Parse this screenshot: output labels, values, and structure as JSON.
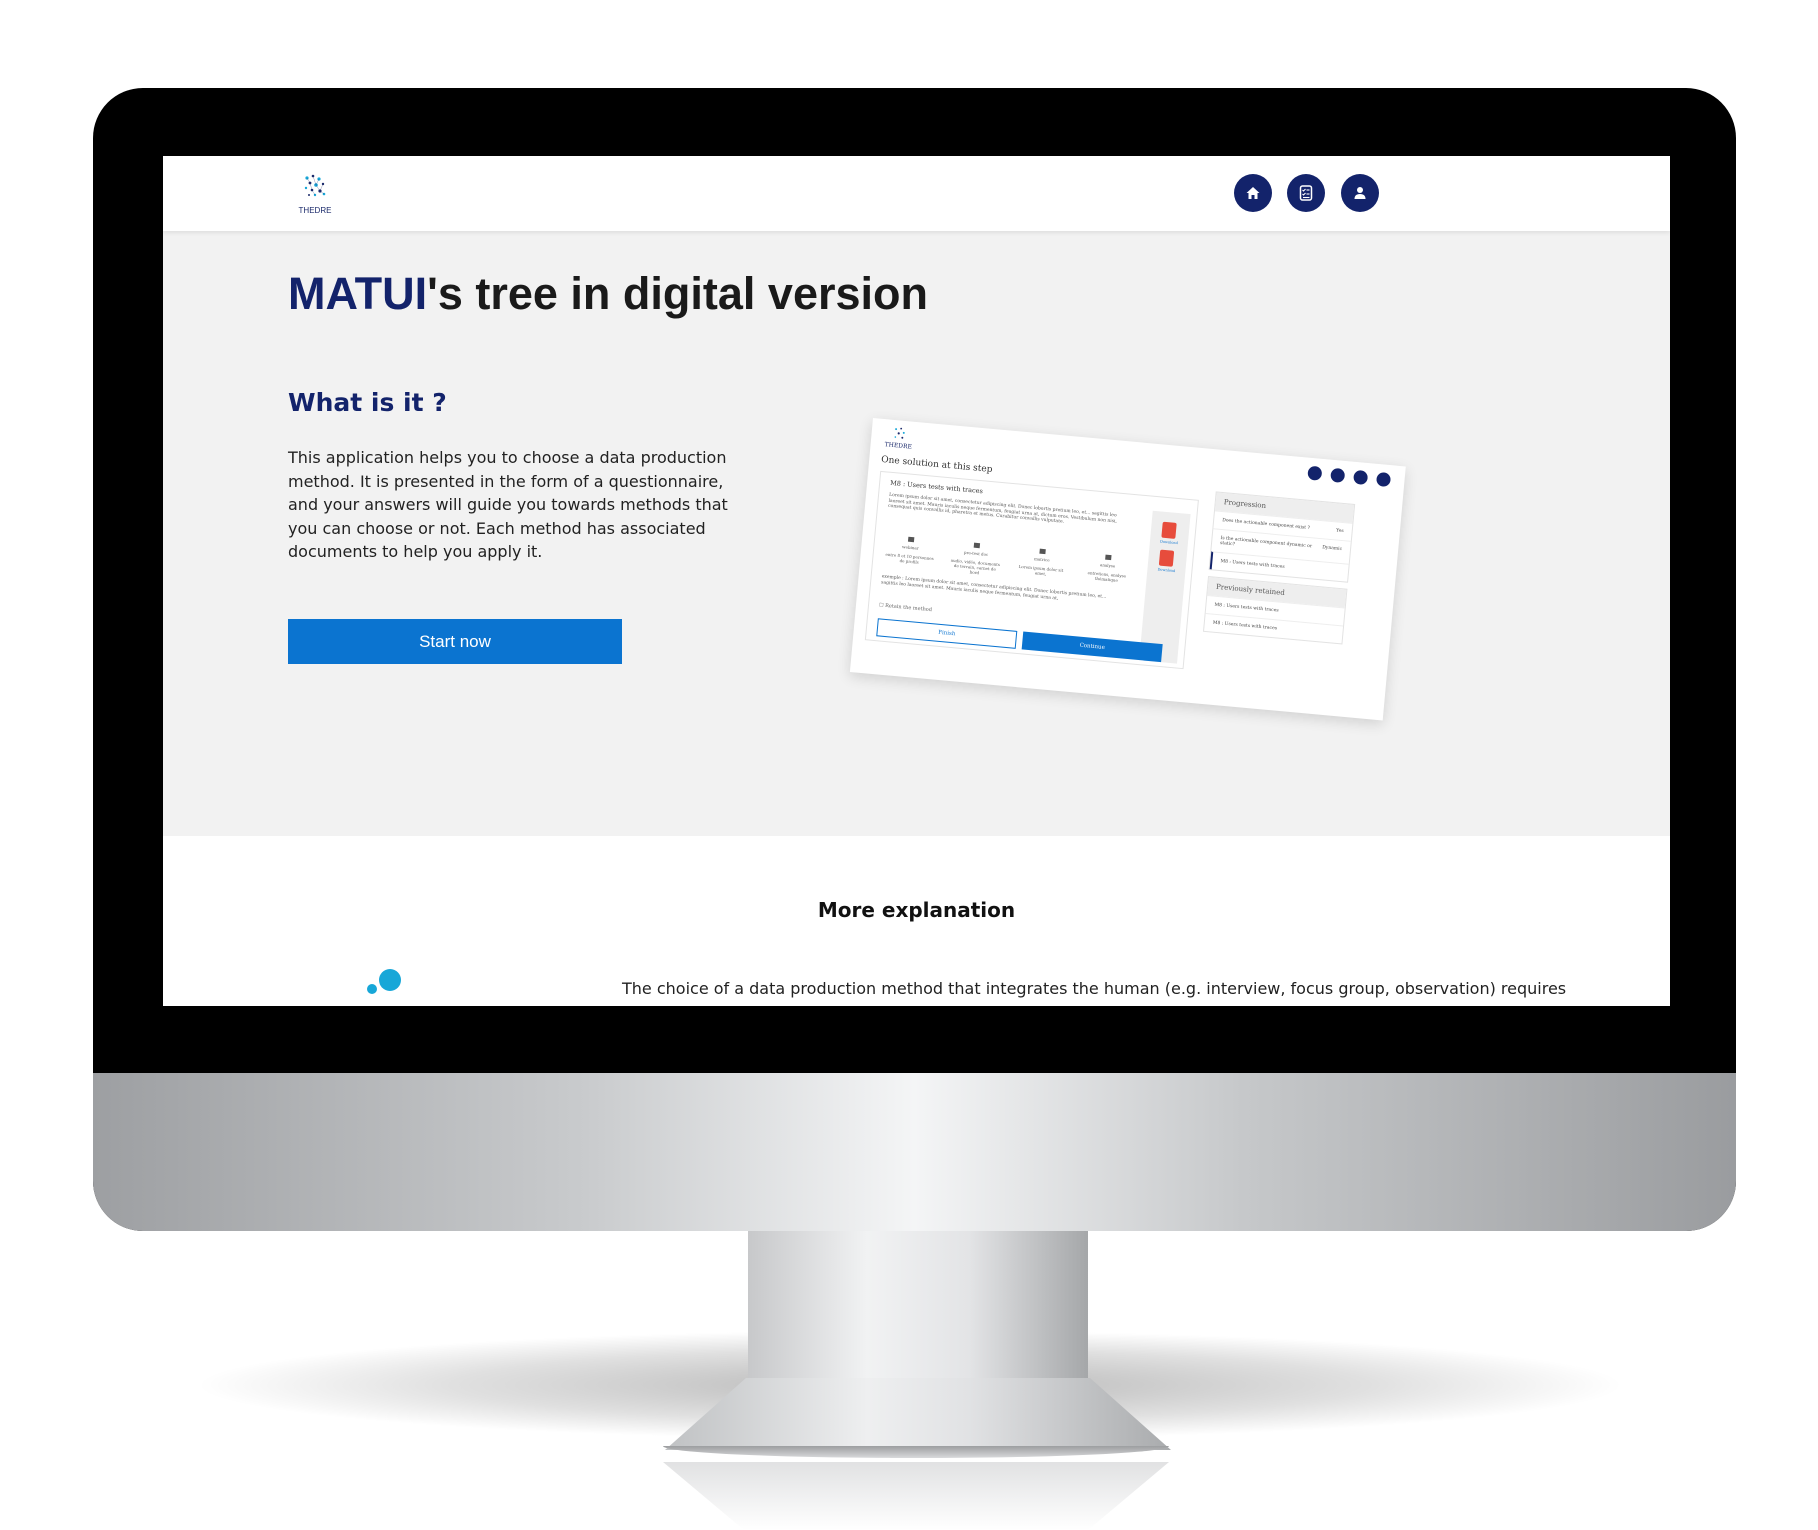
{
  "header": {
    "logo_text": "THEDRE",
    "nav_buttons": [
      {
        "icon": "home-icon"
      },
      {
        "icon": "checklist-icon"
      },
      {
        "icon": "user-icon"
      }
    ]
  },
  "hero": {
    "title_brand": "MATUI",
    "title_rest": "'s tree in digital version"
  },
  "about": {
    "heading": "What is it ?",
    "text": "This application helps you to choose a data production method. It is presented in the form of a questionnaire, and your answers will guide you towards methods that you can choose or not. Each method has associated documents to help you apply it.",
    "start_label": "Start now"
  },
  "preview": {
    "logo_text": "THEDRE",
    "heading": "One solution at this step",
    "card_title": "M8 : Users tests with traces",
    "lorem": "Lorem ipsum dolor sit amet, consectetur adipiscing elit. Donec lobortis pretium leo, et... sagittis leo laoreet sit amet. Mauris iaculis neque fermentum, feugiat urna at, dictum eros. Vestibulum non nisi, consequat quis convallis id, pharetra et metus. Curabitur convallis vulputate.",
    "columns": [
      {
        "title": "webinar",
        "text": "entre 8 et 10 personnes de profils"
      },
      {
        "title": "pre-test doc",
        "text": "audio, vidéo, documents de terrain, carnet de bord"
      },
      {
        "title": "matrice",
        "text": "Lorem ipsum dolor sit amet,"
      },
      {
        "title": "analyse",
        "text": "entretiens, analyse thématique"
      }
    ],
    "example": "exemple : Lorem ipsum dolor sit amet, consectetur adipiscing elit. Donec lobortis pretium leo, et... sagittis leo laoreet sit amet. Mauris iaculis neque fermentum, feugiat urna at,",
    "checkbox_label": "Retain the method",
    "download_label": "Download",
    "finish_label": "Finish",
    "continue_label": "Continue",
    "progression": {
      "title": "Progression",
      "rows": [
        {
          "q": "Does the actionable component exist ?",
          "a": "Yes"
        },
        {
          "q": "Is the actionable component dynamic or static?",
          "a": "Dynamic"
        },
        {
          "q": "M8 : Users tests with traces",
          "a": ""
        }
      ]
    },
    "retained": {
      "title": "Previously retained",
      "rows": [
        "M8 : Users tests with traces",
        "M8 : Users tests with traces"
      ]
    }
  },
  "more": {
    "heading": "More explanation",
    "text": "The choice of a data production method that integrates the human (e.g. interview, focus group, observation) requires"
  },
  "colors": {
    "brand_navy": "#13236b",
    "button_blue": "#0b74d0",
    "accent_cyan": "#17a7d8"
  }
}
